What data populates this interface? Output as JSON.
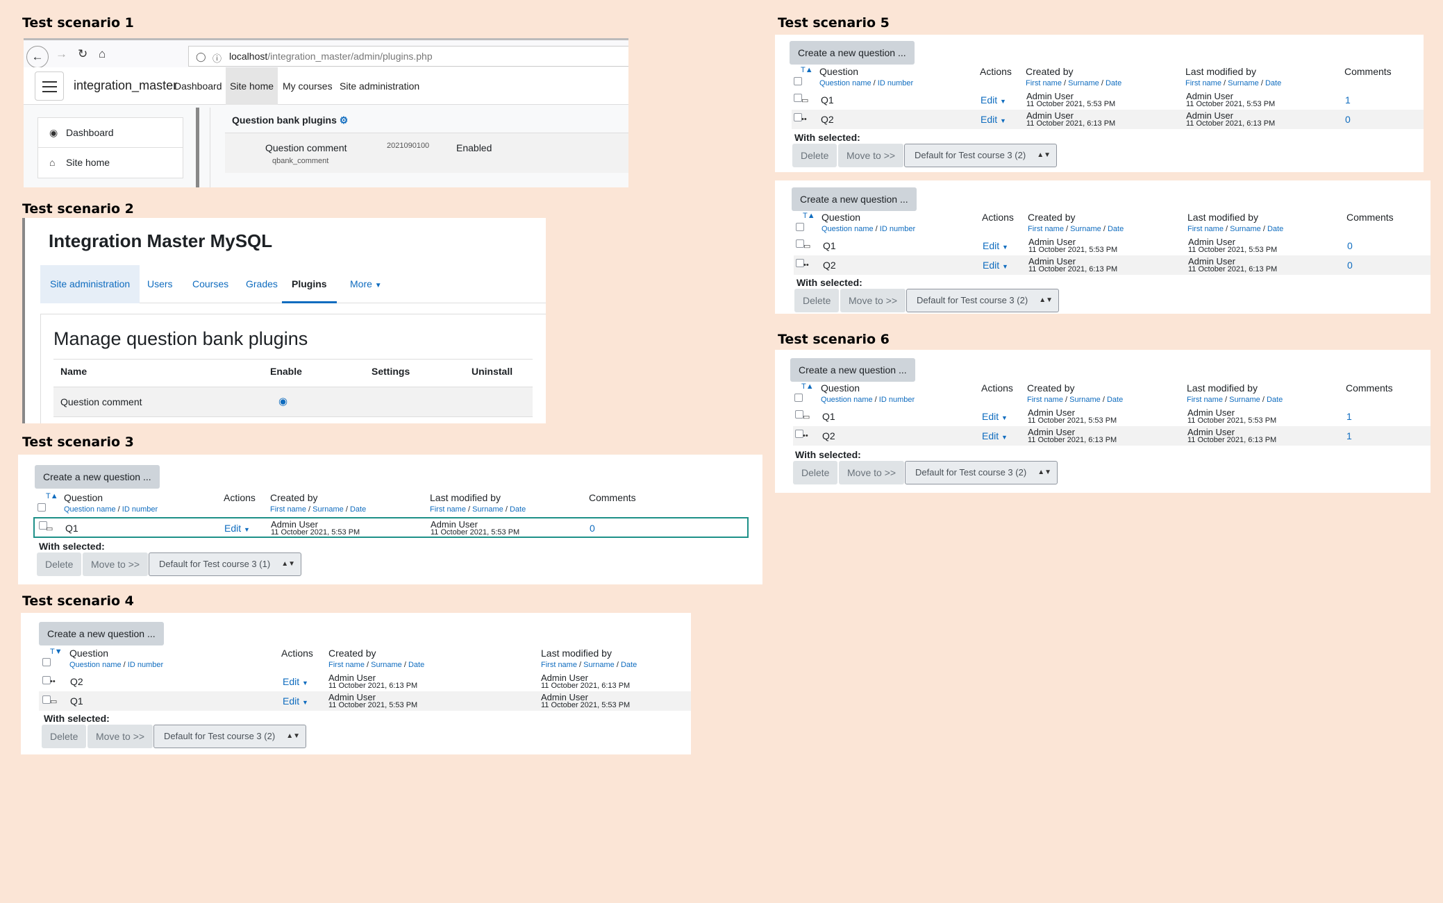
{
  "scenario_titles": [
    "Test scenario 1",
    "Test scenario 2",
    "Test scenario 3",
    "Test scenario 4",
    "Test scenario 5",
    "Test scenario 6"
  ],
  "s1": {
    "url_host": "localhost",
    "url_path": "/integration_master/admin/plugins.php",
    "site_name": "integration_master",
    "nav": [
      "Dashboard",
      "Site home",
      "My courses",
      "Site administration"
    ],
    "drawer": [
      "Dashboard",
      "Site home"
    ],
    "section": "Question bank plugins",
    "plugin_name": "Question comment",
    "plugin_component": "qbank_comment",
    "plugin_version": "2021090100",
    "plugin_status": "Enabled"
  },
  "s2": {
    "site_title": "Integration Master MySQL",
    "tabs": [
      "Site administration",
      "Users",
      "Courses",
      "Grades",
      "Plugins",
      "More"
    ],
    "heading": "Manage question bank plugins",
    "cols": [
      "Name",
      "Enable",
      "Settings",
      "Uninstall"
    ],
    "row_name": "Question comment"
  },
  "common": {
    "create_btn": "Create a new question ...",
    "col_question": "Question",
    "col_actions": "Actions",
    "col_created": "Created by",
    "col_modified": "Last modified by",
    "col_comments": "Comments",
    "sub_q1": "Question name",
    "sub_q2": "ID number",
    "sub_p1": "First name",
    "sub_p2": "Surname",
    "sub_p3": "Date",
    "sep": "/",
    "edit": "Edit",
    "with_selected": "With selected:",
    "delete": "Delete",
    "move": "Move to >>",
    "user": "Admin User",
    "d553": "11 October 2021, 5:53 PM",
    "d613": "11 October 2021, 6:13 PM",
    "q1": "Q1",
    "q2": "Q2",
    "sort_t": "T",
    "cat_1": "Default for Test course 3 (1)",
    "cat_2": "Default for Test course 3 (2)"
  },
  "comments": {
    "s3": [
      "0"
    ],
    "s5a": [
      "1",
      "0"
    ],
    "s5b": [
      "0",
      "0"
    ],
    "s6": [
      "1",
      "1"
    ]
  },
  "colors": {
    "background": "#fbe5d6",
    "link": "#0f6cbf",
    "highlight": "#1d9088"
  }
}
